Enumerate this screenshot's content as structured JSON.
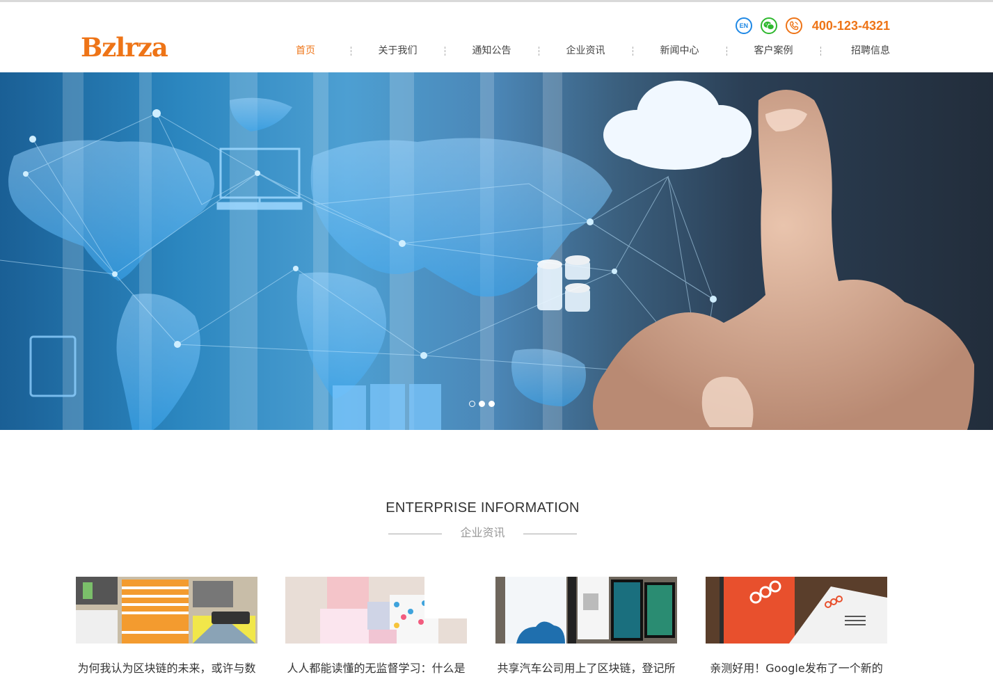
{
  "header": {
    "logo": "Bzlrza",
    "lang_label": "EN",
    "phone": "400-123-4321"
  },
  "nav": {
    "items": [
      {
        "label": "首页",
        "active": true
      },
      {
        "label": "关于我们",
        "active": false
      },
      {
        "label": "通知公告",
        "active": false
      },
      {
        "label": "企业资讯",
        "active": false
      },
      {
        "label": "新闻中心",
        "active": false
      },
      {
        "label": "客户案例",
        "active": false
      },
      {
        "label": "招聘信息",
        "active": false
      }
    ]
  },
  "banner": {
    "slides": 3,
    "current": 1
  },
  "section": {
    "title": "ENTERPRISE INFORMATION",
    "subtitle": "企业资讯"
  },
  "articles": [
    {
      "title": "为何我认为区块链的未来，或许与数"
    },
    {
      "title": "人人都能读懂的无监督学习：什么是"
    },
    {
      "title": "共享汽车公司用上了区块链，登记所"
    },
    {
      "title": "亲测好用！Google发布了一个新的"
    }
  ],
  "icons": [
    "en-icon",
    "wechat-icon",
    "phone-icon"
  ],
  "colors": {
    "accent": "#ee7417",
    "en": "#1e88e5",
    "wechat": "#2eb82e"
  }
}
